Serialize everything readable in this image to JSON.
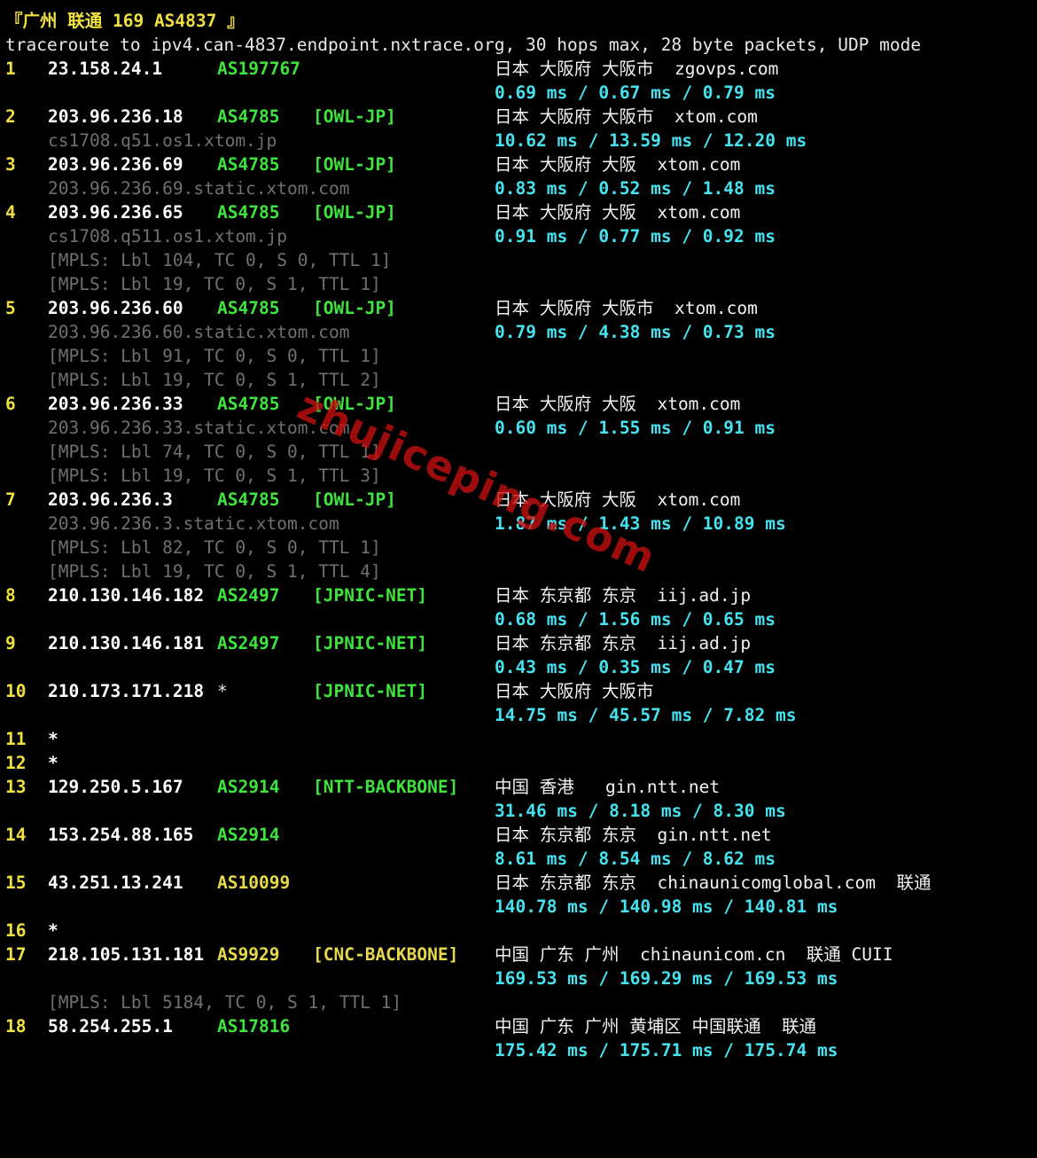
{
  "header": {
    "title": "『广州 联通 169 AS4837 』",
    "command": "traceroute to ipv4.can-4837.endpoint.nxtrace.org, 30 hops max, 28 byte packets, UDP mode"
  },
  "hops": {
    "h1": {
      "num": "1",
      "ip": "23.158.24.1",
      "as": "AS197767",
      "geo": "日本 大阪府 大阪市  zgovps.com",
      "rtt": "0.69 ms / 0.67 ms / 0.79 ms"
    },
    "h2": {
      "num": "2",
      "ip": "203.96.236.18",
      "as": "AS4785",
      "tag": "[OWL-JP]",
      "geo": "日本 大阪府 大阪市  xtom.com",
      "host": "cs1708.q51.os1.xtom.jp",
      "rtt": "10.62 ms / 13.59 ms / 12.20 ms"
    },
    "h3": {
      "num": "3",
      "ip": "203.96.236.69",
      "as": "AS4785",
      "tag": "[OWL-JP]",
      "geo": "日本 大阪府 大阪  xtom.com",
      "host": "203.96.236.69.static.xtom.com",
      "rtt": "0.83 ms / 0.52 ms / 1.48 ms"
    },
    "h4": {
      "num": "4",
      "ip": "203.96.236.65",
      "as": "AS4785",
      "tag": "[OWL-JP]",
      "geo": "日本 大阪府 大阪  xtom.com",
      "host": "cs1708.q511.os1.xtom.jp",
      "rtt": "0.91 ms / 0.77 ms / 0.92 ms",
      "mpls1": "[MPLS: Lbl 104, TC 0, S 0, TTL 1]",
      "mpls2": "[MPLS: Lbl 19, TC 0, S 1, TTL 1]"
    },
    "h5": {
      "num": "5",
      "ip": "203.96.236.60",
      "as": "AS4785",
      "tag": "[OWL-JP]",
      "geo": "日本 大阪府 大阪市  xtom.com",
      "host": "203.96.236.60.static.xtom.com",
      "rtt": "0.79 ms / 4.38 ms / 0.73 ms",
      "mpls1": "[MPLS: Lbl 91, TC 0, S 0, TTL 1]",
      "mpls2": "[MPLS: Lbl 19, TC 0, S 1, TTL 2]"
    },
    "h6": {
      "num": "6",
      "ip": "203.96.236.33",
      "as": "AS4785",
      "tag": "[OWL-JP]",
      "geo": "日本 大阪府 大阪  xtom.com",
      "host": "203.96.236.33.static.xtom.com",
      "rtt": "0.60 ms / 1.55 ms / 0.91 ms",
      "mpls1": "[MPLS: Lbl 74, TC 0, S 0, TTL 1]",
      "mpls2": "[MPLS: Lbl 19, TC 0, S 1, TTL 3]"
    },
    "h7": {
      "num": "7",
      "ip": "203.96.236.3",
      "as": "AS4785",
      "tag": "[OWL-JP]",
      "geo": "日本 大阪府 大阪  xtom.com",
      "host": "203.96.236.3.static.xtom.com",
      "rtt": "1.87 ms / 1.43 ms / 10.89 ms",
      "mpls1": "[MPLS: Lbl 82, TC 0, S 0, TTL 1]",
      "mpls2": "[MPLS: Lbl 19, TC 0, S 1, TTL 4]"
    },
    "h8": {
      "num": "8",
      "ip": "210.130.146.182",
      "as": "AS2497",
      "tag": "[JPNIC-NET]",
      "geo": "日本 东京都 东京  iij.ad.jp",
      "rtt": "0.68 ms / 1.56 ms / 0.65 ms"
    },
    "h9": {
      "num": "9",
      "ip": "210.130.146.181",
      "as": "AS2497",
      "tag": "[JPNIC-NET]",
      "geo": "日本 东京都 东京  iij.ad.jp",
      "rtt": "0.43 ms / 0.35 ms / 0.47 ms"
    },
    "h10": {
      "num": "10",
      "ip": "210.173.171.218",
      "as": "*",
      "tag": "[JPNIC-NET]",
      "geo": "日本 大阪府 大阪市",
      "rtt": "14.75 ms / 45.57 ms / 7.82 ms"
    },
    "h11": {
      "num": "11",
      "ip": "*"
    },
    "h12": {
      "num": "12",
      "ip": "*"
    },
    "h13": {
      "num": "13",
      "ip": "129.250.5.167",
      "as": "AS2914",
      "tag": "[NTT-BACKBONE]",
      "geo": "中国 香港   gin.ntt.net",
      "rtt": "31.46 ms / 8.18 ms / 8.30 ms"
    },
    "h14": {
      "num": "14",
      "ip": "153.254.88.165",
      "as": "AS2914",
      "geo": "日本 东京都 东京  gin.ntt.net",
      "rtt": "8.61 ms / 8.54 ms / 8.62 ms"
    },
    "h15": {
      "num": "15",
      "ip": "43.251.13.241",
      "as": "AS10099",
      "geo": "日本 东京都 东京  chinaunicomglobal.com  联通",
      "rtt": "140.78 ms / 140.98 ms / 140.81 ms"
    },
    "h16": {
      "num": "16",
      "ip": "*"
    },
    "h17": {
      "num": "17",
      "ip": "218.105.131.181",
      "as": "AS9929",
      "tag": "[CNC-BACKBONE]",
      "geo": "中国 广东 广州  chinaunicom.cn  联通 CUII",
      "rtt": "169.53 ms / 169.29 ms / 169.53 ms",
      "mpls1": "[MPLS: Lbl 5184, TC 0, S 1, TTL 1]"
    },
    "h18": {
      "num": "18",
      "ip": "58.254.255.1",
      "as": "AS17816",
      "geo": "中国 广东 广州 黄埔区 中国联通  联通",
      "rtt": "175.42 ms / 175.71 ms / 175.74 ms"
    }
  },
  "watermark": "zhujiceping.com"
}
